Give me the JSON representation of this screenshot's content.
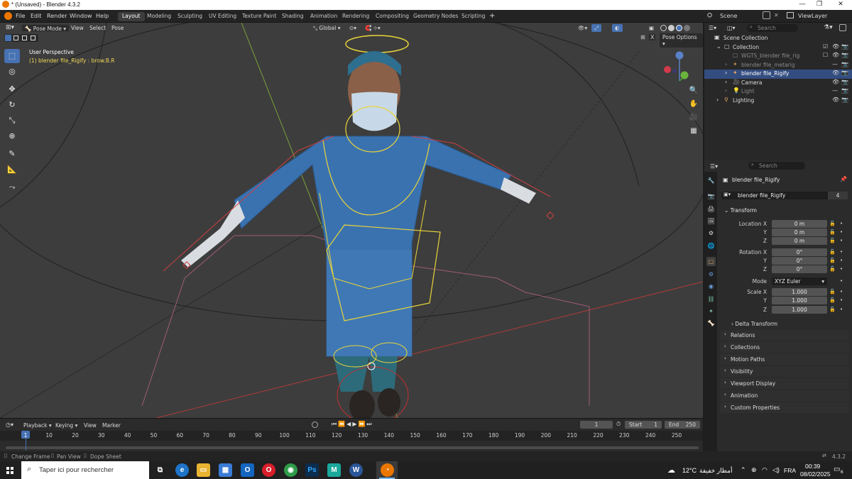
{
  "window": {
    "title": "* (Unsaved) - Blender 4.3.2",
    "minimize": "—",
    "maximize": "❐",
    "close": "✕"
  },
  "menu": {
    "file": "File",
    "edit": "Edit",
    "render": "Render",
    "window": "Window",
    "help": "Help"
  },
  "workspaces": [
    "Layout",
    "Modeling",
    "Sculpting",
    "UV Editing",
    "Texture Paint",
    "Shading",
    "Animation",
    "Rendering",
    "Compositing",
    "Geometry Nodes",
    "Scripting"
  ],
  "add_workspace": "+",
  "scene": {
    "name": "Scene",
    "view_layer": "ViewLayer"
  },
  "viewport": {
    "mode": "Pose Mode",
    "menus": [
      "View",
      "Select",
      "Pose"
    ],
    "orientation": "Global",
    "pose_options": "Pose Options",
    "x_mirror": "X",
    "perspective_label": "User Perspective",
    "object_label": "(1) blender file_Rigify : brow.B.R"
  },
  "outliner": {
    "search_placeholder": "Search",
    "rows": [
      {
        "label": "Scene Collection"
      },
      {
        "label": "Collection"
      },
      {
        "label": "WGTS_blender file_rig"
      },
      {
        "label": "blender file_metarig"
      },
      {
        "label": "blender file_Rigify"
      },
      {
        "label": "Camera"
      },
      {
        "label": "Light"
      },
      {
        "label": "Lighting"
      }
    ]
  },
  "properties": {
    "search_placeholder": "Search",
    "object_name": "blender file_Rigify",
    "data_name": "blender file_Rigify",
    "users": "4",
    "transform": {
      "title": "Transform",
      "location_label": "Location X",
      "loc_x": "0 m",
      "loc_y": "0 m",
      "loc_z": "0 m",
      "rotation_label": "Rotation X",
      "rot_x": "0°",
      "rot_y": "0°",
      "rot_z": "0°",
      "mode_label": "Mode",
      "mode": "XYZ Euler",
      "scale_label": "Scale X",
      "scale_x": "1.000",
      "scale_y": "1.000",
      "scale_z": "1.000",
      "y_label": "Y",
      "z_label": "Z"
    },
    "delta_transform": "Delta Transform",
    "panels": [
      "Relations",
      "Collections",
      "Motion Paths",
      "Visibility",
      "Viewport Display",
      "Animation",
      "Custom Properties"
    ]
  },
  "timeline": {
    "menus": [
      "Playback",
      "Keying",
      "View",
      "Marker"
    ],
    "current_frame": "1",
    "start_label": "Start",
    "start": "1",
    "end_label": "End",
    "end": "250",
    "ticks": [
      "1",
      "10",
      "20",
      "30",
      "40",
      "50",
      "60",
      "70",
      "80",
      "90",
      "100",
      "110",
      "120",
      "130",
      "140",
      "150",
      "160",
      "170",
      "180",
      "190",
      "200",
      "210",
      "220",
      "230",
      "240",
      "250"
    ]
  },
  "statusbar": {
    "change_frame": "Change Frame",
    "pan_view": "Pan View",
    "dope_sheet": "Dope Sheet",
    "version": "4.3.2"
  },
  "taskbar": {
    "search_placeholder": "Taper ici pour rechercher",
    "weather_temp": "12°C",
    "weather_desc": "أمطار خفيفة",
    "language": "FRA",
    "time": "00:39",
    "date": "08/02/2025",
    "notification_count": "6"
  },
  "colors": {
    "accent": "#4772b3",
    "selected_row": "#334d80",
    "header_bg": "#232323",
    "viewport_bg": "#3d3d3d"
  }
}
